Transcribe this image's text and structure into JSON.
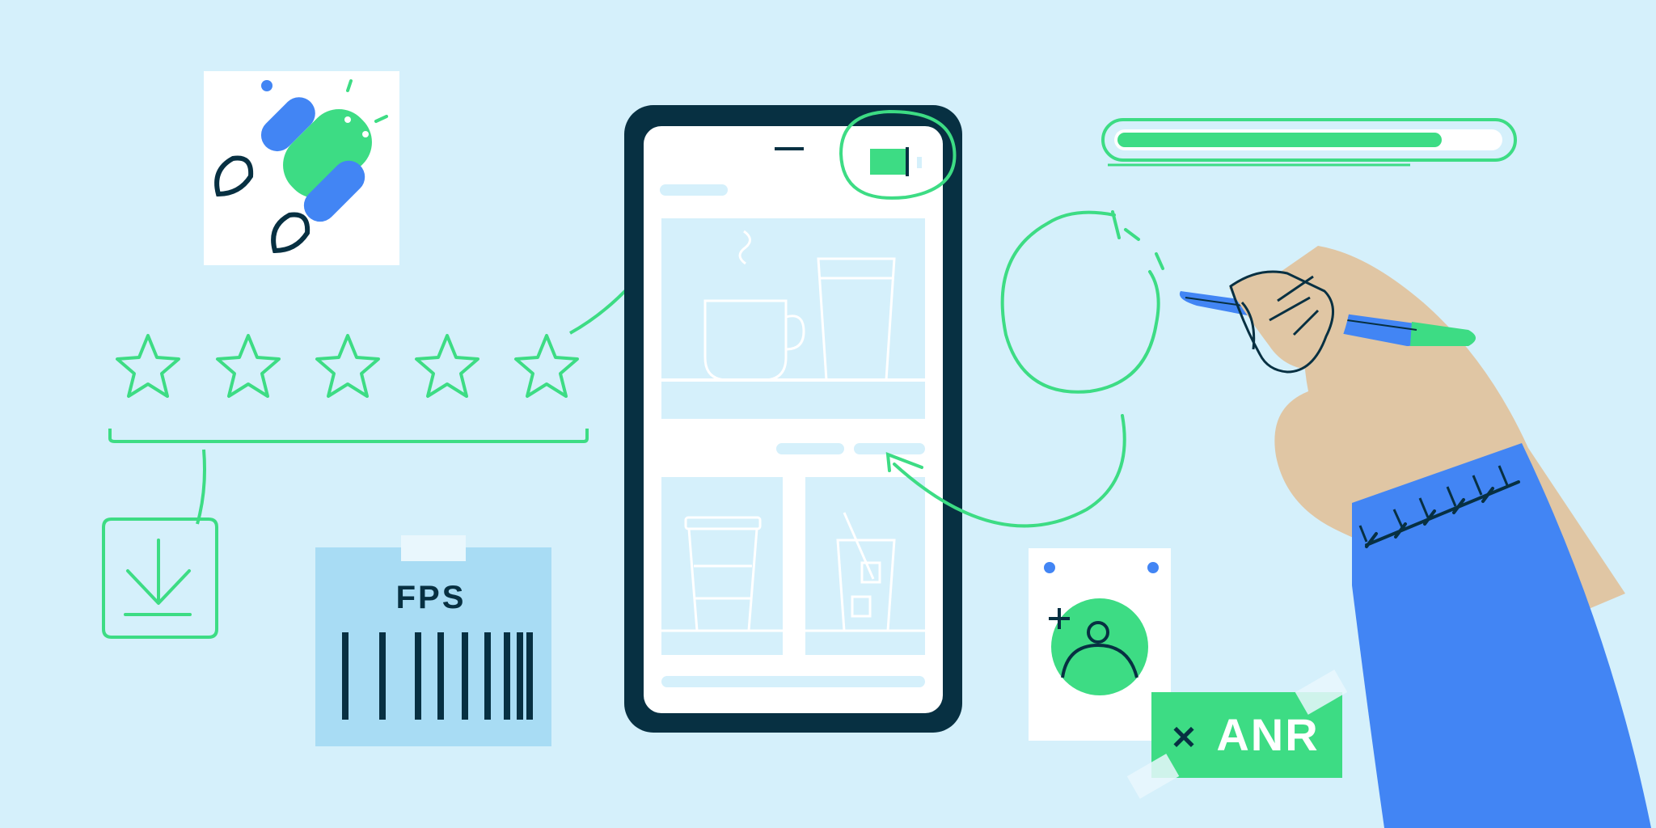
{
  "labels": {
    "fps": "FPS",
    "anr": "ANR",
    "anr_close_glyph": "✕"
  },
  "rating": {
    "stars_total": 5,
    "stars_filled": 0
  },
  "progress": {
    "fill_fraction": 0.85
  },
  "colors": {
    "background": "#d5f0fb",
    "accent_green": "#3ddc84",
    "accent_blue": "#4285f4",
    "phone_frame": "#073042",
    "pale_blue": "#d5f0fb",
    "light_blue_panel": "#a8dcf4",
    "skin": "#e0c6a4"
  },
  "icons": [
    "android-rocket-icon",
    "star-icon",
    "download-icon",
    "barcode-icon",
    "add-user-icon",
    "battery-icon",
    "coffee-cup-icon",
    "glass-icon",
    "takeaway-cup-icon",
    "iced-drink-icon",
    "pen-icon"
  ]
}
